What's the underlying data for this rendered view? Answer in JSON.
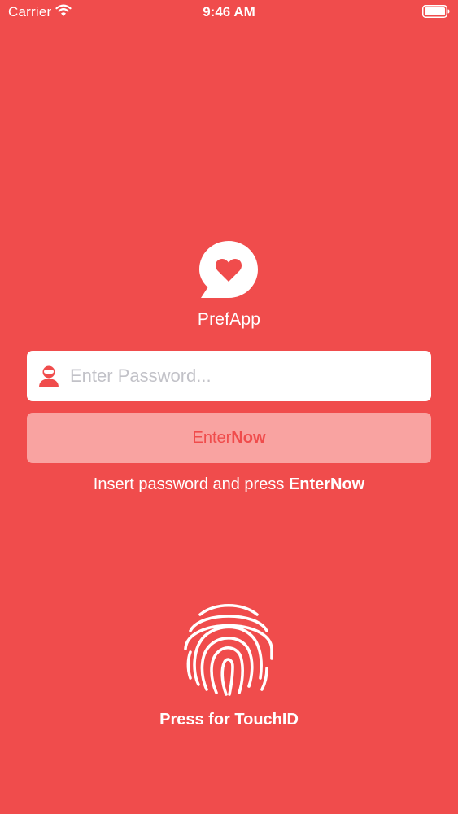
{
  "status_bar": {
    "carrier": "Carrier",
    "time": "9:46 AM",
    "wifi_icon": "wifi-icon",
    "battery_icon": "battery-icon"
  },
  "app": {
    "name": "PrefApp",
    "logo_icon": "heart-chat-bubble-icon"
  },
  "password": {
    "placeholder": "Enter Password...",
    "value": "",
    "icon": "user-icon"
  },
  "enter_button": {
    "label_part1": "Enter",
    "label_part2": "Now"
  },
  "hint": {
    "text": "Insert password and press ",
    "emphasis": "EnterNow"
  },
  "touch_id": {
    "icon": "fingerprint-icon",
    "label": "Press for TouchID"
  },
  "colors": {
    "background": "#F04C4C",
    "button": "#F9A3A1",
    "field": "#FFFFFF",
    "placeholder": "#C2C2C8"
  }
}
